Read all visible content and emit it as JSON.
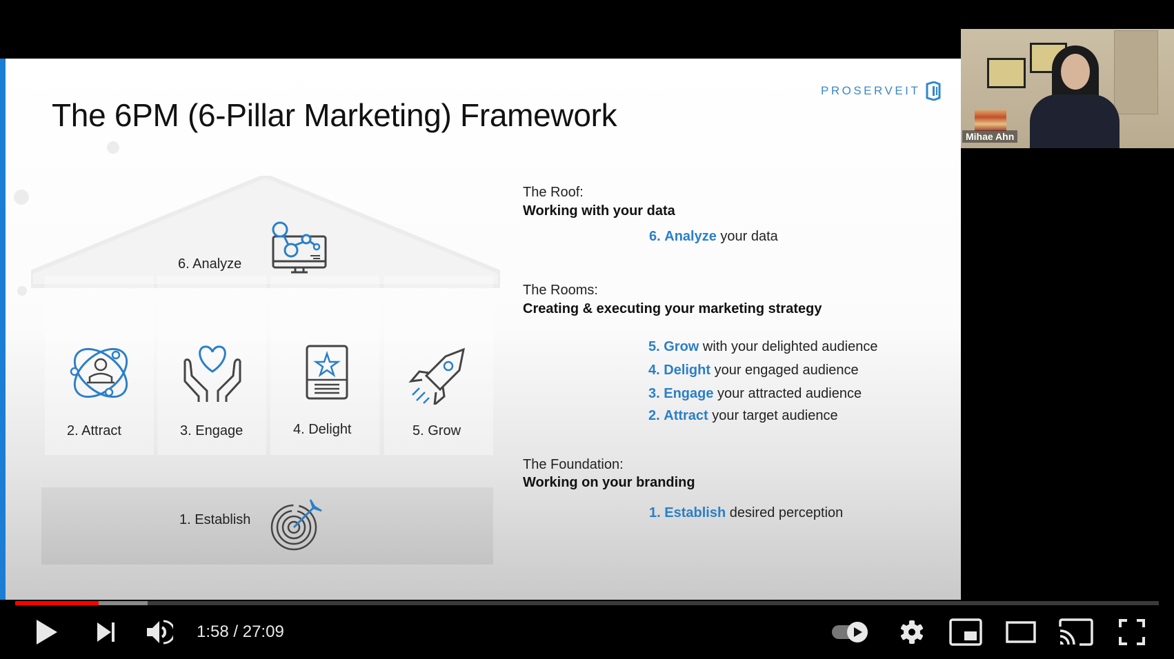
{
  "slide": {
    "title": "The 6PM (6-Pillar Marketing) Framework",
    "logo_text": "PROSERVEIT",
    "accent_color": "#1a7fd4",
    "keyword_color": "#2a7fc8",
    "house": {
      "roof": {
        "label": "6. Analyze",
        "icon": "monitor-analytics-icon"
      },
      "rooms": [
        {
          "label": "2. Attract",
          "icon": "atom-person-icon"
        },
        {
          "label": "3. Engage",
          "icon": "hands-heart-icon"
        },
        {
          "label": "4. Delight",
          "icon": "star-card-icon"
        },
        {
          "label": "5. Grow",
          "icon": "rocket-icon"
        }
      ],
      "foundation": {
        "label": "1. Establish",
        "icon": "target-arrow-icon"
      }
    },
    "sections": {
      "roof": {
        "heading": "The Roof:",
        "subheading": "Working with your data",
        "items": [
          {
            "num": "6.",
            "keyword": "Analyze",
            "rest": " your data"
          }
        ]
      },
      "rooms": {
        "heading": "The Rooms:",
        "subheading": "Creating & executing your marketing strategy",
        "items": [
          {
            "num": "5.",
            "keyword": "Grow",
            "rest": " with your delighted audience"
          },
          {
            "num": "4.",
            "keyword": "Delight",
            "rest": " your engaged audience"
          },
          {
            "num": "3.",
            "keyword": "Engage",
            "rest": " your attracted audience"
          },
          {
            "num": "2.",
            "keyword": "Attract",
            "rest": " your target audience"
          }
        ]
      },
      "foundation": {
        "heading": "The Foundation:",
        "subheading": "Working on your branding",
        "items": [
          {
            "num": "1.",
            "keyword": "Establish",
            "rest": " desired perception"
          }
        ]
      }
    }
  },
  "webcam": {
    "name": "Mihae Ahn"
  },
  "player": {
    "current_time": "1:58",
    "separator": " / ",
    "duration": "27:09",
    "progress_played_pct": 7.3,
    "progress_buffered_pct": 11.6,
    "autoplay_on": true,
    "controls": {
      "play": "play-icon",
      "next": "next-icon",
      "volume": "volume-icon",
      "autoplay": "autoplay-toggle",
      "settings": "gear-icon",
      "miniplayer": "miniplayer-icon",
      "theater": "theater-mode-icon",
      "cast": "cast-icon",
      "fullscreen": "fullscreen-icon"
    }
  }
}
